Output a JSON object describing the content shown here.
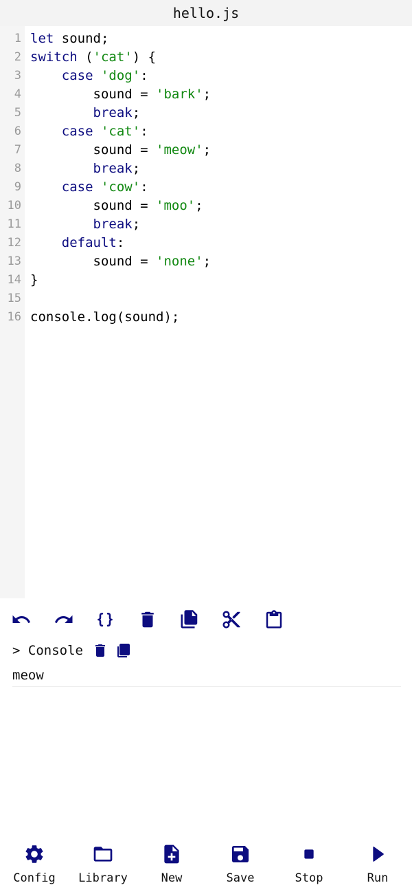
{
  "title": "hello.js",
  "colors": {
    "icon": "#0d0d80",
    "keyword": "#0d0d80",
    "string": "#118811",
    "gutter_bg": "#f5f5f5",
    "titlebar_bg": "#f3f3f3"
  },
  "editor": {
    "lines": [
      {
        "number": "1",
        "tokens": [
          {
            "t": "let",
            "c": "kw"
          },
          {
            "t": " sound;",
            "c": ""
          }
        ]
      },
      {
        "number": "2",
        "tokens": [
          {
            "t": "switch",
            "c": "kw"
          },
          {
            "t": " (",
            "c": ""
          },
          {
            "t": "'cat'",
            "c": "str"
          },
          {
            "t": ") {",
            "c": ""
          }
        ]
      },
      {
        "number": "3",
        "tokens": [
          {
            "t": "    ",
            "c": ""
          },
          {
            "t": "case",
            "c": "kw"
          },
          {
            "t": " ",
            "c": ""
          },
          {
            "t": "'dog'",
            "c": "str"
          },
          {
            "t": ":",
            "c": ""
          }
        ]
      },
      {
        "number": "4",
        "tokens": [
          {
            "t": "        sound = ",
            "c": ""
          },
          {
            "t": "'bark'",
            "c": "str"
          },
          {
            "t": ";",
            "c": ""
          }
        ]
      },
      {
        "number": "5",
        "tokens": [
          {
            "t": "        ",
            "c": ""
          },
          {
            "t": "break",
            "c": "kw"
          },
          {
            "t": ";",
            "c": ""
          }
        ]
      },
      {
        "number": "6",
        "tokens": [
          {
            "t": "    ",
            "c": ""
          },
          {
            "t": "case",
            "c": "kw"
          },
          {
            "t": " ",
            "c": ""
          },
          {
            "t": "'cat'",
            "c": "str"
          },
          {
            "t": ":",
            "c": ""
          }
        ]
      },
      {
        "number": "7",
        "tokens": [
          {
            "t": "        sound = ",
            "c": ""
          },
          {
            "t": "'meow'",
            "c": "str"
          },
          {
            "t": ";",
            "c": ""
          }
        ]
      },
      {
        "number": "8",
        "tokens": [
          {
            "t": "        ",
            "c": ""
          },
          {
            "t": "break",
            "c": "kw"
          },
          {
            "t": ";",
            "c": ""
          }
        ]
      },
      {
        "number": "9",
        "tokens": [
          {
            "t": "    ",
            "c": ""
          },
          {
            "t": "case",
            "c": "kw"
          },
          {
            "t": " ",
            "c": ""
          },
          {
            "t": "'cow'",
            "c": "str"
          },
          {
            "t": ":",
            "c": ""
          }
        ]
      },
      {
        "number": "10",
        "tokens": [
          {
            "t": "        sound = ",
            "c": ""
          },
          {
            "t": "'moo'",
            "c": "str"
          },
          {
            "t": ";",
            "c": ""
          }
        ]
      },
      {
        "number": "11",
        "tokens": [
          {
            "t": "        ",
            "c": ""
          },
          {
            "t": "break",
            "c": "kw"
          },
          {
            "t": ";",
            "c": ""
          }
        ]
      },
      {
        "number": "12",
        "tokens": [
          {
            "t": "    ",
            "c": ""
          },
          {
            "t": "default",
            "c": "kw"
          },
          {
            "t": ":",
            "c": ""
          }
        ]
      },
      {
        "number": "13",
        "tokens": [
          {
            "t": "        sound = ",
            "c": ""
          },
          {
            "t": "'none'",
            "c": "str"
          },
          {
            "t": ";",
            "c": ""
          }
        ]
      },
      {
        "number": "14",
        "tokens": [
          {
            "t": "}",
            "c": ""
          }
        ]
      },
      {
        "number": "15",
        "tokens": []
      },
      {
        "number": "16",
        "tokens": [
          {
            "t": "console.log(sound);",
            "c": ""
          }
        ]
      }
    ]
  },
  "toolbar": {
    "icons": [
      "undo-icon",
      "redo-icon",
      "format-braces-icon",
      "delete-icon",
      "copy-icon",
      "cut-icon",
      "paste-icon"
    ]
  },
  "console": {
    "label": "> Console",
    "icons": [
      "clear-console-icon",
      "copy-console-icon"
    ],
    "output": "meow"
  },
  "nav": {
    "config": "Config",
    "library": "Library",
    "new": "New",
    "save": "Save",
    "stop": "Stop",
    "run": "Run"
  }
}
